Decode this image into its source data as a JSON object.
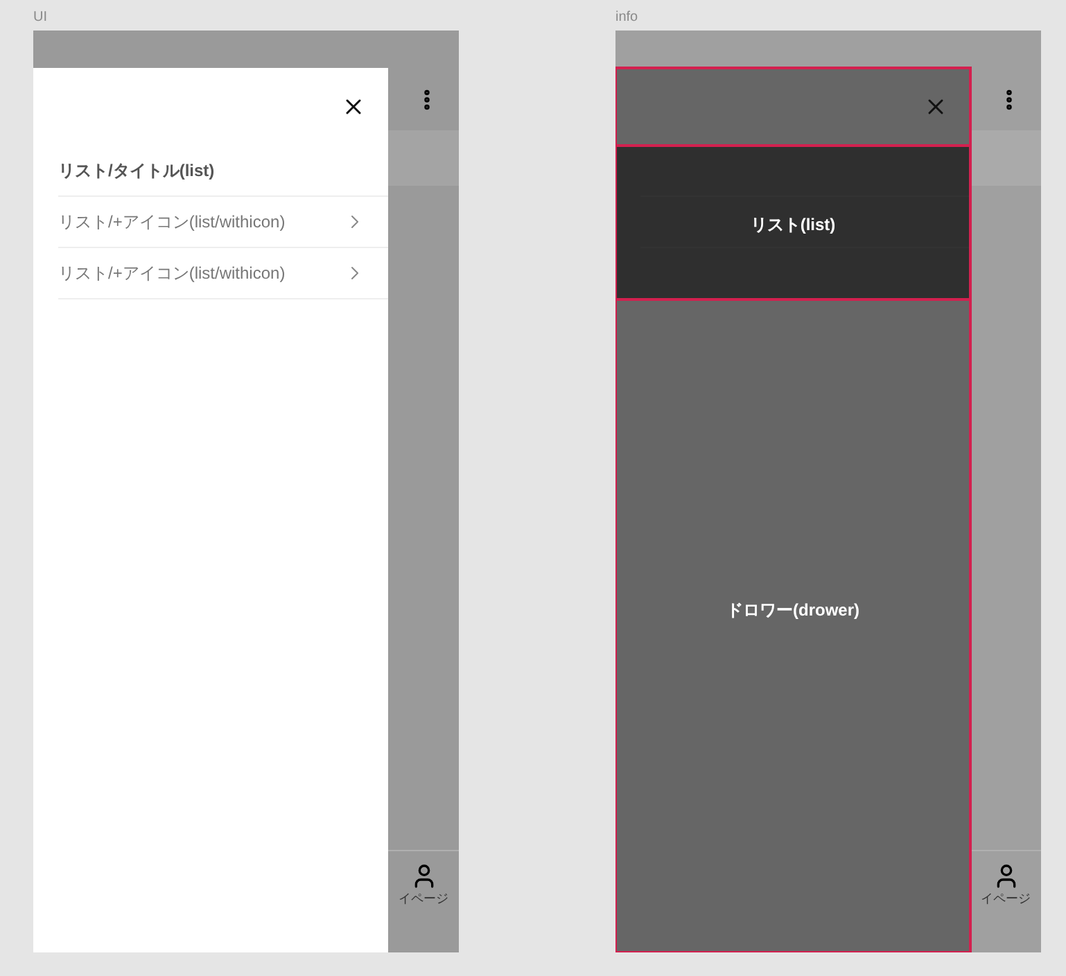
{
  "frames": [
    {
      "label": "UI",
      "kind": "plain",
      "app": {
        "nav_label": "イページ"
      },
      "drawer": {
        "list_title": "リスト/タイトル(list)",
        "items": [
          {
            "label": "リスト/+アイコン(list/withicon)"
          },
          {
            "label": "リスト/+アイコン(list/withicon)"
          }
        ]
      }
    },
    {
      "label": "info",
      "kind": "annotated",
      "app": {
        "nav_label": "イページ"
      },
      "annotations": {
        "list": "リスト(list)",
        "drawer": "ドロワー(drower)"
      }
    }
  ]
}
